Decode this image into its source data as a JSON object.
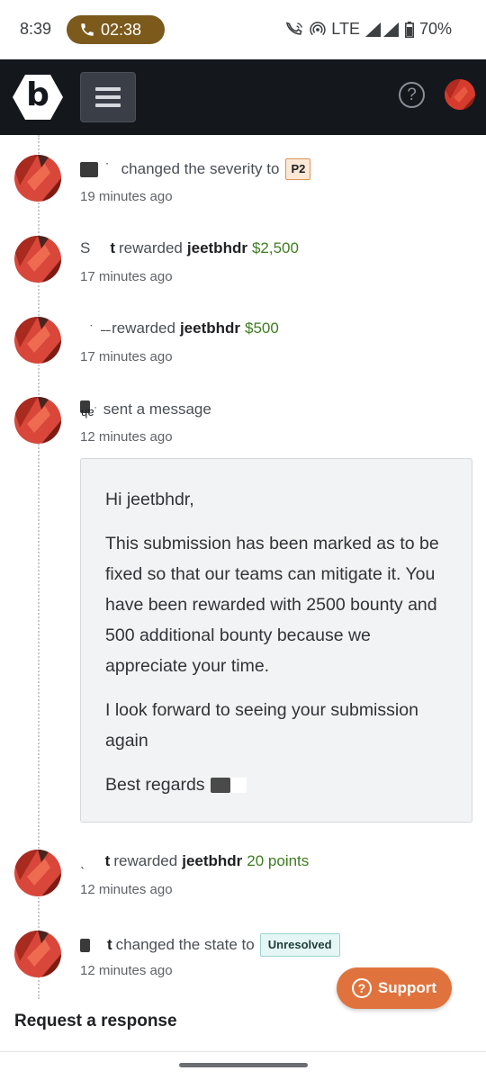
{
  "status_bar": {
    "time": "8:39",
    "call_timer": "02:38",
    "network": "LTE",
    "battery": "70%"
  },
  "app_bar": {
    "logo_letter": "b",
    "help_symbol": "?"
  },
  "events": [
    {
      "actor": "",
      "action_fragment": "changed the severity to",
      "actor_tail": "˙",
      "badge": "P2",
      "time": "19 minutes ago"
    },
    {
      "actor": "S",
      "actor_tail": "t",
      "action": "rewarded",
      "user": "jeetbhdr",
      "amount": "$2,500",
      "time": "17 minutes ago"
    },
    {
      "actor": "ˑ",
      "actor_tail": "˗˗",
      "action": "rewarded",
      "user": "jeetbhdr",
      "amount": "$500",
      "time": "17 minutes ago"
    },
    {
      "actor": "ɥɐ˙",
      "action": "sent a message",
      "time": "12 minutes ago"
    },
    {
      "actor": "ˎ",
      "actor_tail": "t",
      "action": "rewarded",
      "user": "jeetbhdr",
      "amount": "20 points",
      "time": "12 minutes ago"
    },
    {
      "actor": "",
      "actor_tail": "t",
      "action": "changed the state to",
      "badge": "Unresolved",
      "time": "12 minutes ago"
    }
  ],
  "message": {
    "greeting": "Hi jeetbhdr,",
    "paragraph1": "This submission has been marked as to be fixed so that our teams can mitigate it. You have been rewarded with 2500 bounty and 500 additional bounty because we appreciate your time.",
    "paragraph2": "I look forward to seeing your submission again",
    "signoff": "Best regards"
  },
  "support_button": {
    "label": "Support",
    "icon": "question-circle-icon"
  },
  "request_response_label": "Request a response",
  "colors": {
    "app_bar": "#14171c",
    "reward_green": "#3f7d20",
    "support_orange": "#e0733d",
    "call_pill": "#7b5a1c"
  }
}
